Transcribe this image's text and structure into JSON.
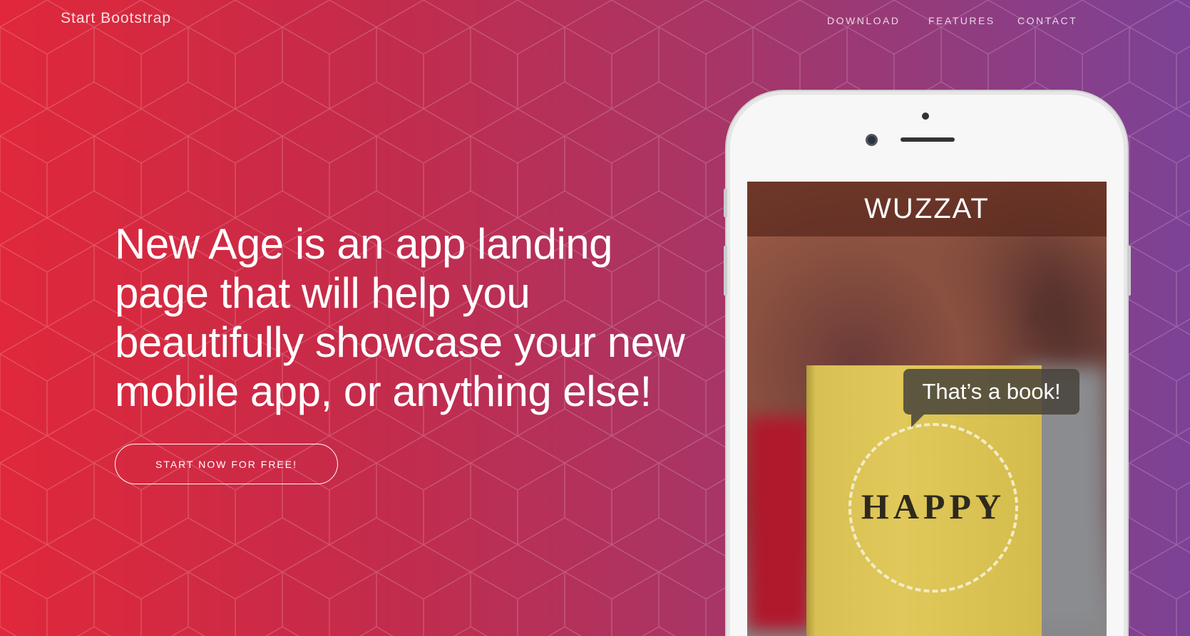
{
  "navbar": {
    "brand": "Start Bootstrap",
    "links": [
      "Download",
      "Features",
      "Contact"
    ]
  },
  "hero": {
    "headline": "New Age is an app landing page that will help you beautifully showcase your new mobile app, or anything else!",
    "cta_label": "Start Now for Free!"
  },
  "phone_screen": {
    "app_title": "WUZZAT",
    "bubble_text": "That’s a book!",
    "book_title": "HAPPY"
  },
  "colors": {
    "gradient_start": "#e0283a",
    "gradient_end": "#7c4296"
  }
}
